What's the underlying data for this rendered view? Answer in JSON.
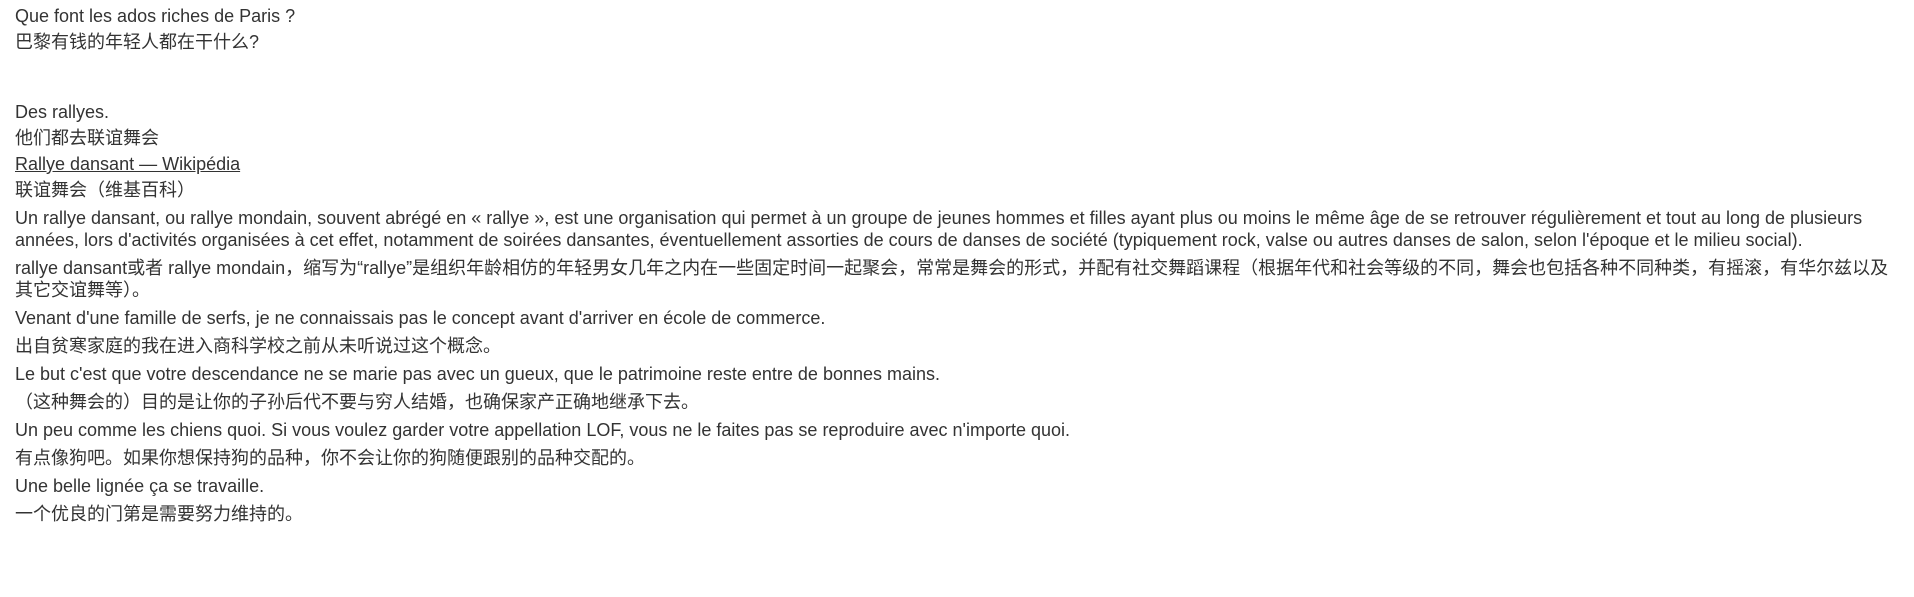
{
  "header": {
    "question_fr": "Que font les ados riches de Paris ?",
    "question_zh": "巴黎有钱的年轻人都在干什么?"
  },
  "content": {
    "answer_fr": "Des rallyes.",
    "answer_zh": "他们都去联谊舞会",
    "link_text": "Rallye dansant — Wikipédia",
    "link_zh": "联谊舞会（维基百科）",
    "def_fr": "Un rallye dansant, ou rallye mondain, souvent abrégé en « rallye », est une organisation qui permet à un groupe de jeunes hommes et filles ayant plus ou moins le même âge de se retrouver régulièrement et tout au long de plusieurs années, lors d'activités organisées à cet effet, notamment de soirées dansantes, éventuellement assorties de cours de danses de société (typiquement rock, valse ou autres danses de salon, selon l'époque et le milieu social).",
    "def_zh": "rallye dansant或者 rallye mondain，缩写为“rallye”是组织年龄相仿的年轻男女几年之内在一些固定时间一起聚会，常常是舞会的形式，并配有社交舞蹈课程（根据年代和社会等级的不同，舞会也包括各种不同种类，有摇滚，有华尔兹以及其它交谊舞等）。",
    "serfs_fr": "Venant d'une famille de serfs, je ne connaissais pas le concept avant d'arriver en école de commerce.",
    "serfs_zh": "出自贫寒家庭的我在进入商科学校之前从未听说过这个概念。",
    "but_fr": "Le but c'est que votre descendance ne se marie pas avec un gueux, que le patrimoine reste entre de bonnes mains.",
    "but_zh": "（这种舞会的）目的是让你的子孙后代不要与穷人结婚，也确保家产正确地继承下去。",
    "chiens_fr": "Un peu comme les chiens quoi. Si vous voulez garder votre appellation LOF, vous ne le faites pas se reproduire avec n'importe quoi.",
    "chiens_zh": "有点像狗吧。如果你想保持狗的品种，你不会让你的狗随便跟别的品种交配的。",
    "lignee_fr": "Une belle lignée ça se travaille.",
    "lignee_zh": "一个优良的门第是需要努力维持的。"
  }
}
